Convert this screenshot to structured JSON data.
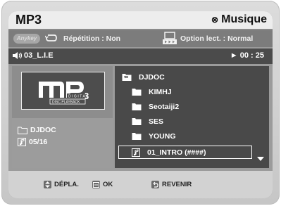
{
  "header": {
    "title": "MP3",
    "mode_label": "Musique",
    "mode_icon": "disc-icon"
  },
  "options": {
    "anykey_label": "Anykey",
    "repeat_label": "Répétition : Non",
    "play_option_label": "Option lect. : Normal"
  },
  "now_playing": {
    "track": "03_L.I.E",
    "time": "► 00 : 25"
  },
  "logo": {
    "text": "MP3",
    "subtitle_line1": "DIGITAL",
    "subtitle_line2": "DISC PLAYBACK"
  },
  "current_info": {
    "folder": "DJDOC",
    "track_position": "05/16"
  },
  "file_list": {
    "parent": "DJDOC",
    "folders": [
      "KIMHJ",
      "Seotaiji2",
      "SES",
      "YOUNG"
    ],
    "selected_file": "01_INTRO (####)"
  },
  "footer": {
    "move_label": "DÉPLA.",
    "ok_label": "OK",
    "return_label": "REVENIR"
  },
  "colors": {
    "list_bg": "#494949",
    "header_bg": "#ededed",
    "bar_bg": "#7c7c7c"
  }
}
